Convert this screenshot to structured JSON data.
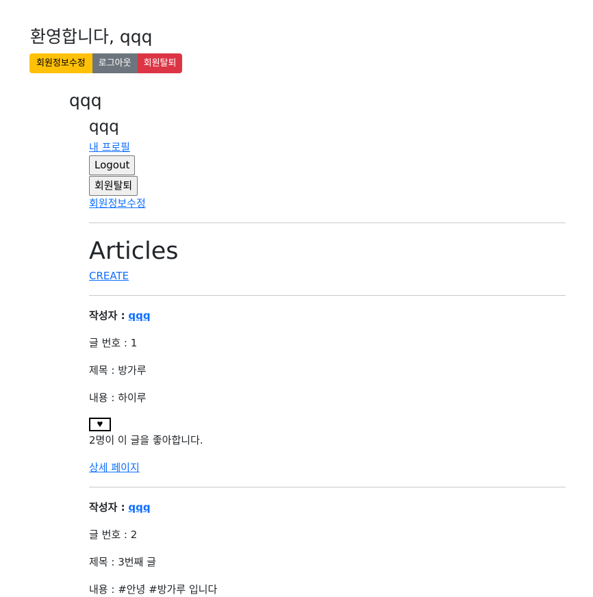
{
  "header": {
    "welcome": "환영합니다, qqq",
    "buttons": {
      "edit_profile": "회원정보수정",
      "logout": "로그아웃",
      "delete_account": "회원탈퇴"
    }
  },
  "user_section": {
    "username_h2": "qqq",
    "username_h3": "qqq",
    "my_profile_link": "내 프로필",
    "logout_button": "Logout",
    "delete_account_button": "회원탈퇴",
    "edit_profile_link": "회원정보수정"
  },
  "articles": {
    "title": "Articles",
    "create_link": "CREATE",
    "items": [
      {
        "author_label": "작성자 :",
        "author": "qqq",
        "number_label": "글 번호 : 1",
        "title_label": "제목 : 방가루",
        "content_label": "내용 : 하이루",
        "like_icon": "heart-icon",
        "likes_text": "2명이 이 글을 좋아합니다.",
        "detail_link": "상세 페이지"
      },
      {
        "author_label": "작성자 :",
        "author": "qqq",
        "number_label": "글 번호 : 2",
        "title_label": "제목 : 3번째 글",
        "content_label": "내용 : #안녕 #방가루 입니다"
      }
    ]
  },
  "colors": {
    "warning": "#ffc107",
    "secondary": "#6c757d",
    "danger": "#dc3545",
    "link": "#0d6efd"
  }
}
